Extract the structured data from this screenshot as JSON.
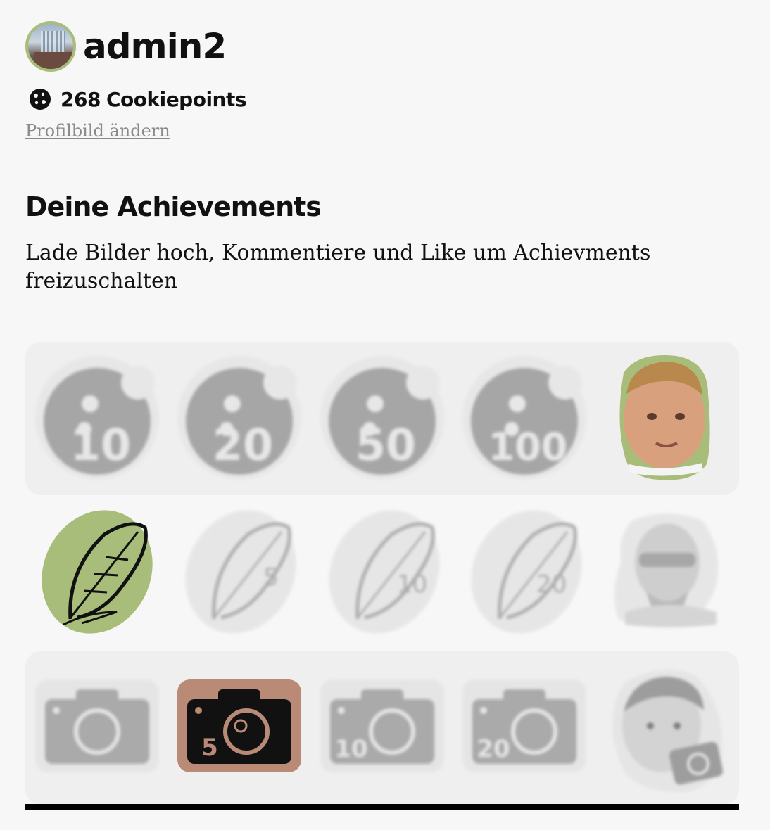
{
  "profile": {
    "username": "admin2",
    "cookiepoints_value": "268",
    "cookiepoints_label": "Cookiepoints",
    "change_picture_link": "Profilbild ändern"
  },
  "achievements": {
    "title": "Deine Achievements",
    "description": "Lade Bilder hoch, Kommentiere und Like um Achievments freizuschalten",
    "rows": [
      {
        "badges": [
          {
            "icon": "cookie-badge-icon",
            "number": "10",
            "unlocked": false
          },
          {
            "icon": "cookie-badge-icon",
            "number": "20",
            "unlocked": false
          },
          {
            "icon": "cookie-badge-icon",
            "number": "50",
            "unlocked": false
          },
          {
            "icon": "cookie-badge-icon",
            "number": "100",
            "unlocked": false
          },
          {
            "icon": "chef-face-badge-icon",
            "unlocked": true
          }
        ]
      },
      {
        "badges": [
          {
            "icon": "quill-badge-icon",
            "unlocked": true
          },
          {
            "icon": "quill-badge-icon",
            "number": "5",
            "unlocked": false
          },
          {
            "icon": "quill-badge-icon",
            "number": "10",
            "unlocked": false
          },
          {
            "icon": "quill-badge-icon",
            "number": "20",
            "unlocked": false
          },
          {
            "icon": "poet-face-badge-icon",
            "unlocked": false
          }
        ]
      },
      {
        "badges": [
          {
            "icon": "camera-badge-icon",
            "unlocked": false
          },
          {
            "icon": "camera-badge-icon",
            "number": "5",
            "unlocked": true
          },
          {
            "icon": "camera-badge-icon",
            "number": "10",
            "unlocked": false
          },
          {
            "icon": "camera-badge-icon",
            "number": "20",
            "unlocked": false
          },
          {
            "icon": "kid-camera-badge-icon",
            "unlocked": false
          }
        ]
      }
    ]
  },
  "colors": {
    "accent_green": "#a8bd7a",
    "accent_copper": "#b98a75",
    "locked_grey": "#9e9e9e"
  }
}
